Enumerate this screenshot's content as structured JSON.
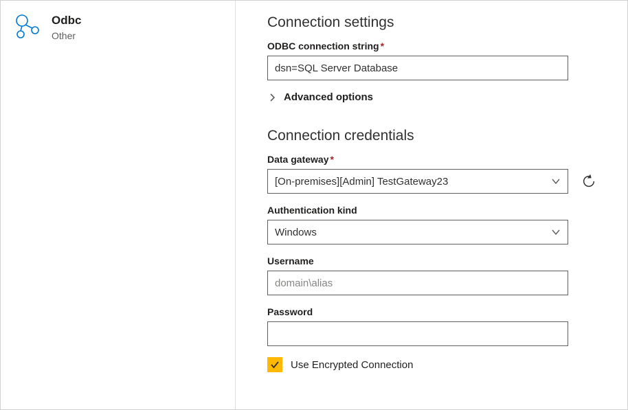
{
  "connector": {
    "title": "Odbc",
    "subtitle": "Other"
  },
  "settings": {
    "heading": "Connection settings",
    "connectionString": {
      "label": "ODBC connection string",
      "required": true,
      "value": "dsn=SQL Server Database"
    },
    "advancedLabel": "Advanced options"
  },
  "credentials": {
    "heading": "Connection credentials",
    "gateway": {
      "label": "Data gateway",
      "required": true,
      "value": "[On-premises][Admin] TestGateway23"
    },
    "authKind": {
      "label": "Authentication kind",
      "value": "Windows"
    },
    "username": {
      "label": "Username",
      "placeholder": "domain\\alias",
      "value": ""
    },
    "password": {
      "label": "Password",
      "value": ""
    },
    "encrypted": {
      "label": "Use Encrypted Connection",
      "checked": true
    }
  }
}
